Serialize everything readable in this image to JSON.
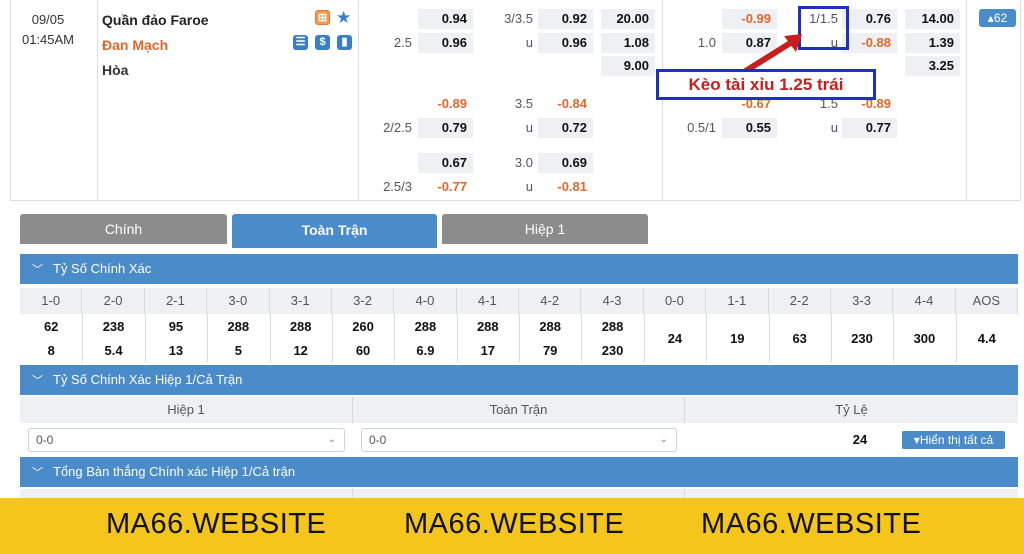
{
  "match": {
    "date": "09/05",
    "time": "01:45AM",
    "home_team": "Quần đảo Faroe",
    "away_team": "Đan Mạch",
    "draw_label": "Hòa",
    "badge_count": "62"
  },
  "fulltime_1x2": [
    "20.00",
    "1.08",
    "9.00"
  ],
  "fulltime_hdp": [
    {
      "line": "",
      "home": "0.94",
      "away": "0.96",
      "away_line": "2.5"
    },
    {
      "line": "",
      "home": "-0.89",
      "away": "0.79",
      "away_line": "2/2.5"
    },
    {
      "line": "",
      "home": "0.67",
      "away": "-0.77",
      "away_line": "2.5/3"
    }
  ],
  "fulltime_ou": [
    {
      "line": "3/3.5",
      "over": "0.92",
      "under_label": "u",
      "under": "0.96"
    },
    {
      "line": "3.5",
      "over": "-0.84",
      "under_label": "u",
      "under": "0.72"
    },
    {
      "line": "3.0",
      "over": "0.69",
      "under_label": "u",
      "under": "-0.81"
    }
  ],
  "half_hdp": [
    {
      "home": "-0.99",
      "away_line": "1.0",
      "away": "0.87"
    },
    {
      "home": "-0.67",
      "away_line": "0.5/1",
      "away": "0.55"
    }
  ],
  "half_ou": [
    {
      "line": "1/1.5",
      "over": "0.76",
      "under_label": "u",
      "under": "-0.88"
    },
    {
      "line": "1.5",
      "over": "-0.89",
      "under_label": "u",
      "under": "0.77"
    }
  ],
  "half_1x2": [
    "14.00",
    "1.39",
    "3.25"
  ],
  "annotation": "Kèo tài xỉu 1.25 trái",
  "tabs": [
    "Chính",
    "Toàn Trận",
    "Hiệp 1"
  ],
  "sections": {
    "correct_score": "Tỷ Số Chính Xác",
    "ht_ft_score": "Tỷ Số Chính Xác Hiệp 1/Cả Trận",
    "total_goals": "Tổng Bàn thắng Chính xác Hiệp 1/Cả trận"
  },
  "correct_score": {
    "headers": [
      "1-0",
      "2-0",
      "2-1",
      "3-0",
      "3-1",
      "3-2",
      "4-0",
      "4-1",
      "4-2",
      "4-3",
      "0-0",
      "1-1",
      "2-2",
      "3-3",
      "4-4",
      "AOS"
    ],
    "home": [
      "62",
      "238",
      "95",
      "288",
      "288",
      "260",
      "288",
      "288",
      "288",
      "288"
    ],
    "away": [
      "8",
      "5.4",
      "13",
      "5",
      "12",
      "60",
      "6.9",
      "17",
      "79",
      "230"
    ],
    "draws": [
      "24",
      "19",
      "63",
      "230",
      "300",
      "4.4"
    ]
  },
  "htft": {
    "col1": "Hiệp 1",
    "col2": "Toàn Trận",
    "col3": "Tỷ Lệ",
    "sel1": "0-0",
    "sel2": "0-0",
    "rate": "24",
    "show_all": "Hiển thị tất cả"
  },
  "banner": [
    "MA66.WEBSITE",
    "MA66.WEBSITE",
    "MA66.WEBSITE"
  ],
  "colors": {
    "accent": "#4a8cc9",
    "negative": "#e2672b",
    "banner": "#f4c51a",
    "annotation": "#c81e1e",
    "annotation_border": "#1f2fbf"
  }
}
